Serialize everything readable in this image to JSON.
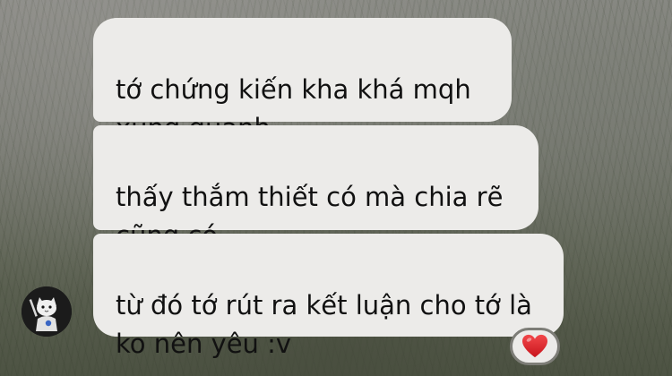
{
  "messages": [
    {
      "text": "tớ chứng kiến kha khá mqh\nxung quanh"
    },
    {
      "text": "thấy thắm thiết có mà chia rẽ\ncũng có"
    },
    {
      "text": "từ đó tớ rút ra kết luận cho tớ là\nko nên yêu :v"
    }
  ],
  "reaction": {
    "icon": "heart-icon",
    "color": "#e0242b"
  },
  "colors": {
    "bubble": "#ecebe9",
    "text": "#111111"
  }
}
